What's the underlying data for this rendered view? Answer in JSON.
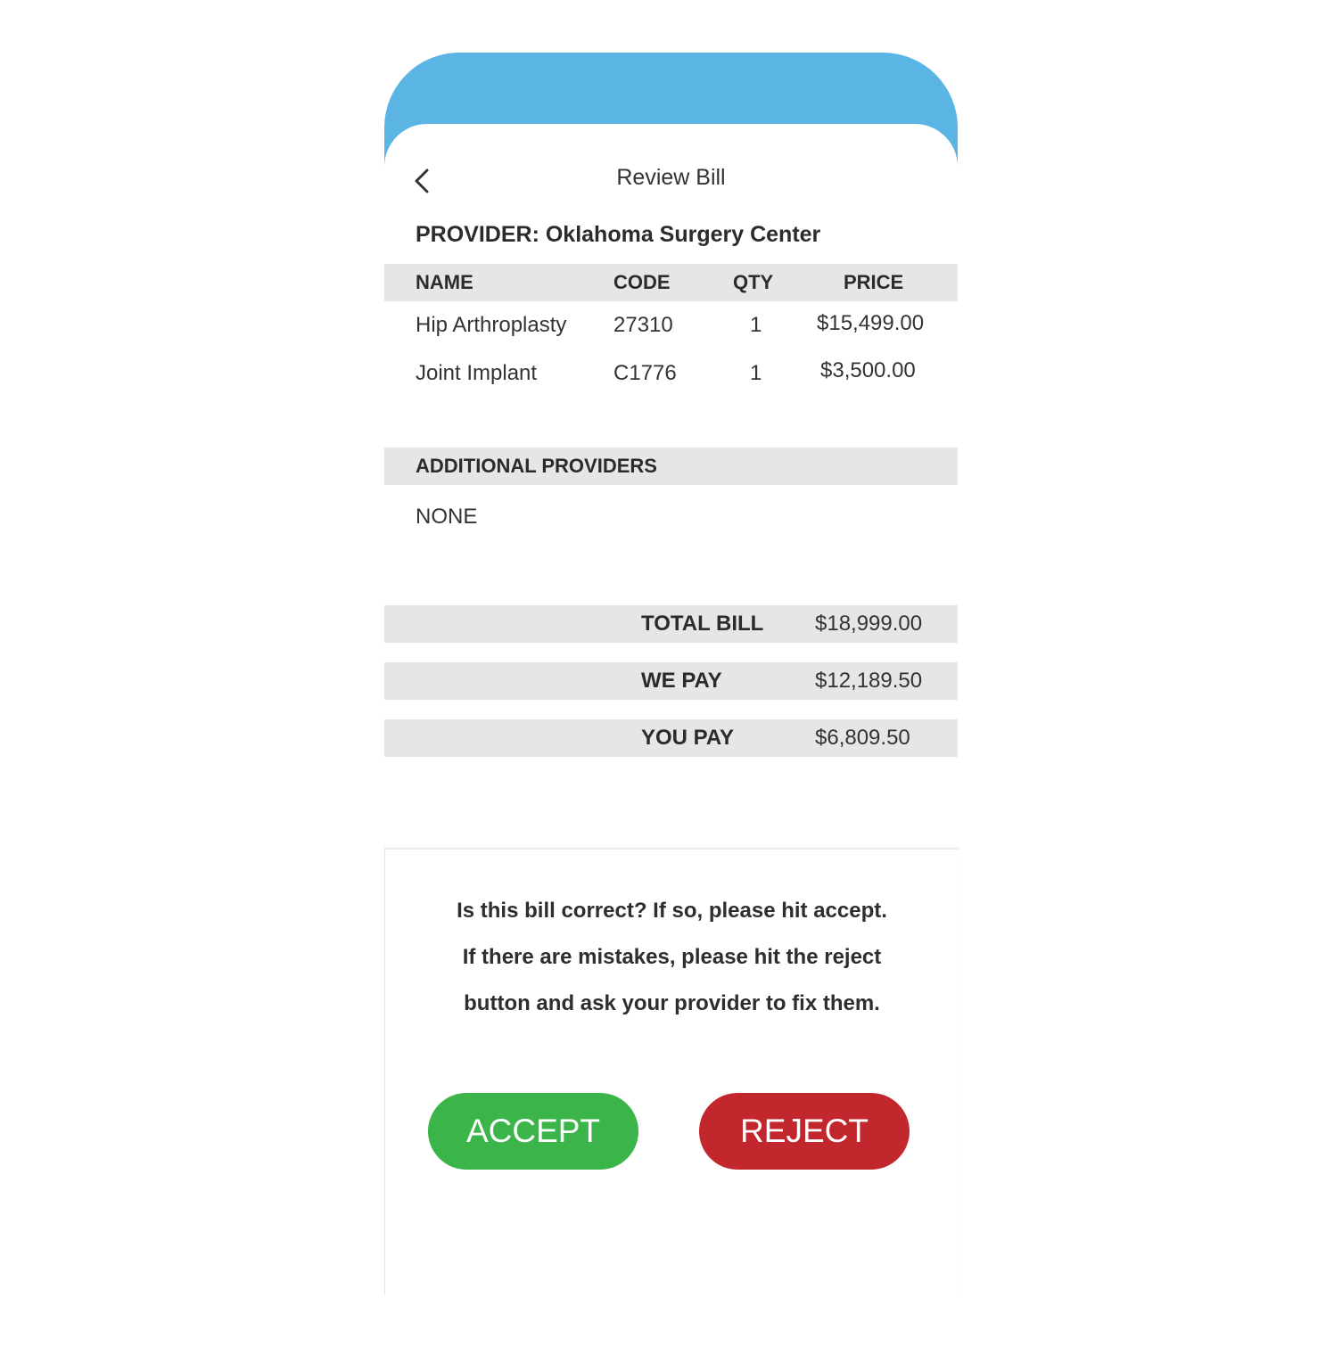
{
  "header": {
    "title": "Review Bill",
    "back_icon": "chevron-left-icon"
  },
  "provider": {
    "label": "PROVIDER: Oklahoma Surgery Center"
  },
  "table": {
    "columns": [
      "NAME",
      "CODE",
      "QTY",
      "PRICE"
    ],
    "rows": [
      {
        "name": "Hip Arthroplasty",
        "code": "27310",
        "qty": "1",
        "price": "$15,499.00"
      },
      {
        "name": "Joint Implant",
        "code": "C1776",
        "qty": "1",
        "price": "$3,500.00"
      }
    ]
  },
  "additional_providers": {
    "heading": "ADDITIONAL PROVIDERS",
    "value": "NONE"
  },
  "summary": {
    "total_label": "TOTAL BILL",
    "total_value": "$18,999.00",
    "we_pay_label": "WE PAY",
    "we_pay_value": "$12,189.50",
    "you_pay_label": "YOU PAY",
    "you_pay_value": "$6,809.50"
  },
  "confirm": {
    "line1": "Is this bill correct? If so, please hit accept.",
    "line2": "If there are mistakes, please hit the reject",
    "line3": "button and ask your provider to fix them.",
    "accept_label": "ACCEPT",
    "reject_label": "REJECT"
  },
  "colors": {
    "header_blue": "#5bb5e4",
    "accept_green": "#3bb54a",
    "reject_red": "#c1272d",
    "band_gray": "#e6e6e6"
  }
}
